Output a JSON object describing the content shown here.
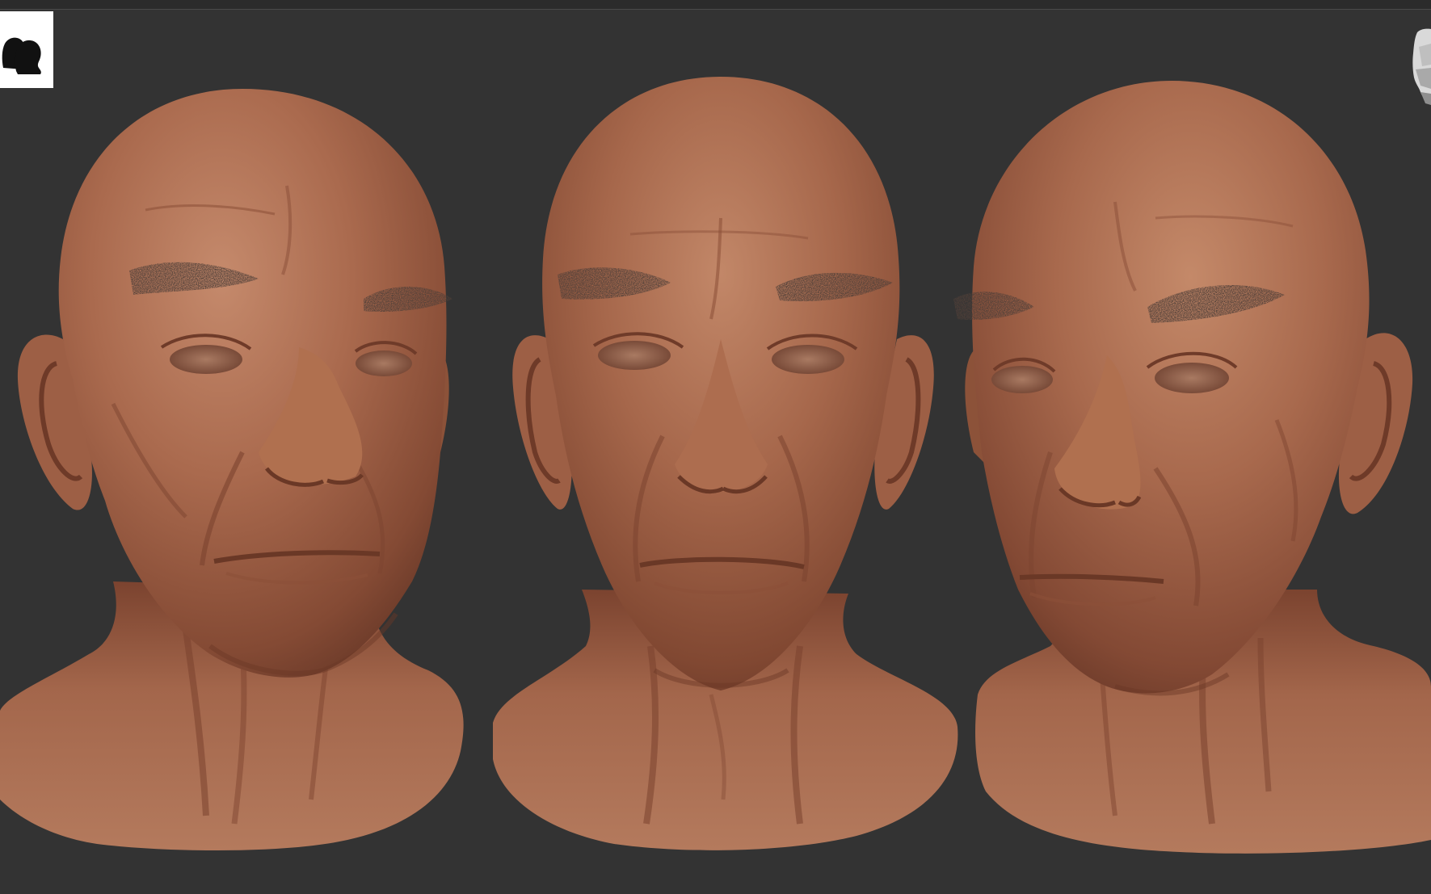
{
  "app": {
    "canvas_background": "#333333",
    "material_color": "#a8694f"
  },
  "viewport": {
    "thumbnail_icon": "two-heads-silhouette-icon",
    "navigation_icon": "head-navigation-gizmo-icon"
  },
  "scene": {
    "views": [
      "three-quarter-left",
      "front",
      "three-quarter-right"
    ]
  }
}
